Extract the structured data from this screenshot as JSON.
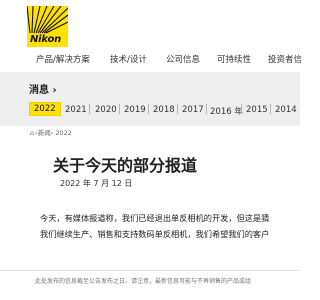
{
  "brand": {
    "logo_text": "Nikon",
    "accent_color": "#ffe100"
  },
  "nav": {
    "items": [
      "产品/解决方案",
      "技术/设计",
      "公司信息",
      "可持续性",
      "投资者信"
    ]
  },
  "news_section": {
    "title": "消息",
    "chevron": "›",
    "years": [
      {
        "label": "2022",
        "active": true
      },
      {
        "label": "2021",
        "active": false
      },
      {
        "label": "2020",
        "active": false
      },
      {
        "label": "2019",
        "active": false
      },
      {
        "label": "2018",
        "active": false
      },
      {
        "label": "2017",
        "active": false
      },
      {
        "label": "2016 年",
        "active": false
      },
      {
        "label": "2015",
        "active": false
      },
      {
        "label": "2014",
        "active": false
      }
    ]
  },
  "breadcrumb": {
    "home_icon": "home-icon",
    "text": "›新闻› 2022"
  },
  "article": {
    "title": "关于今天的部分报道",
    "date": "2022 年 7 月 12 日",
    "paragraph_line1": "今天，有媒体报道称，我们已经退出单反相机的开发，但这是猜",
    "paragraph_line2": "我们继续生产、销售和支持数码单反相机，我们希望我们的客户"
  },
  "footer": {
    "note": "此处发布的信息截至公告发布之日。请注意，最新信息可能与不再销售的产品或组"
  }
}
